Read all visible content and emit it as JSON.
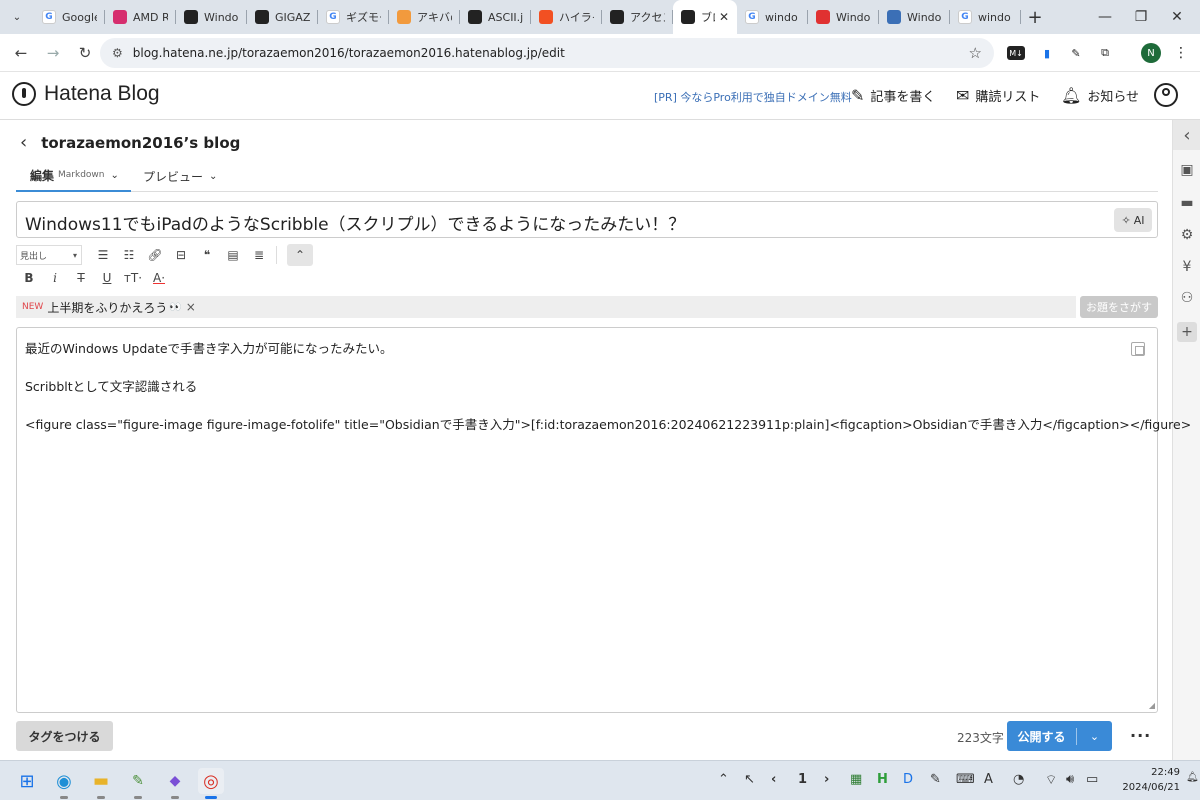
{
  "browser": {
    "tabs": [
      {
        "icon": "google-icon",
        "color": "#ffffff",
        "label": "Google",
        "active": false
      },
      {
        "icon": "amd-icon",
        "color": "#d62e6e",
        "label": "AMD R",
        "active": false
      },
      {
        "icon": "hatena-icon",
        "color": "#222222",
        "label": "Windo",
        "active": false
      },
      {
        "icon": "gigazine-icon",
        "color": "#222222",
        "label": "GIGAZI",
        "active": false
      },
      {
        "icon": "google-icon",
        "color": "#ffffff",
        "label": "ギズモー",
        "active": false
      },
      {
        "icon": "akiba-icon",
        "color": "#f29a3d",
        "label": "アキバの",
        "active": false
      },
      {
        "icon": "ascii-icon",
        "color": "#222222",
        "label": "ASCII.jp",
        "active": false
      },
      {
        "icon": "microsoft-icon",
        "color": "#f25022",
        "label": "ハイライ",
        "active": false
      },
      {
        "icon": "hatena-blog-icon",
        "color": "#222222",
        "label": "アクセス",
        "active": false
      },
      {
        "icon": "hatena-blog-icon",
        "color": "#222222",
        "label": "ブロ",
        "active": true
      },
      {
        "icon": "google-icon",
        "color": "#ffffff",
        "label": "windo",
        "active": false
      },
      {
        "icon": "windows-blog-icon",
        "color": "#e03131",
        "label": "Windo",
        "active": false
      },
      {
        "icon": "person-icon",
        "color": "#3b6fb6",
        "label": "Windo",
        "active": false
      },
      {
        "icon": "google-icon",
        "color": "#ffffff",
        "label": "windo",
        "active": false
      }
    ],
    "url": "blog.hatena.ne.jp/torazaemon2016/torazaemon2016.hatenablog.jp/edit",
    "profile_initial": "N"
  },
  "hatena": {
    "logo": "Hatena Blog",
    "pr_link": "[PR] 今ならPro利用で独自ドメイン無料",
    "write_label": "記事を書く",
    "reading_list_label": "購読リスト",
    "notifications_label": "お知らせ"
  },
  "editor": {
    "blog_name": "torazaemon2016’s blog",
    "tab_edit": "編集",
    "tab_edit_mode": "Markdown",
    "tab_preview": "プレビュー",
    "title": "Windows11でもiPadのようなScribble（スクリプル）できるようになったみたい！？",
    "ai_label": "AI",
    "heading_select": "見出し",
    "topic_new": "NEW",
    "topic_text": "上半期をふりかえろう",
    "topic_emoji": "👀",
    "topic_search": "お題をさがす",
    "body_lines": [
      "最近のWindows Updateで手書き字入力が可能になったみたい。",
      "",
      "Scribbltとして文字認識される",
      "",
      "<figure class=\"figure-image figure-image-fotolife\" title=\"Obsidianで手書き入力\">[f:id:torazaemon2016:20240621223911p:plain]<figcaption>Obsidianで手書き入力</figcaption></figure>"
    ],
    "tag_button": "タグをつける",
    "char_count": "223文字",
    "publish_label": "公開する"
  },
  "taskbar": {
    "page_number": "1",
    "time": "22:49",
    "date": "2024/06/21",
    "ime": "A"
  }
}
